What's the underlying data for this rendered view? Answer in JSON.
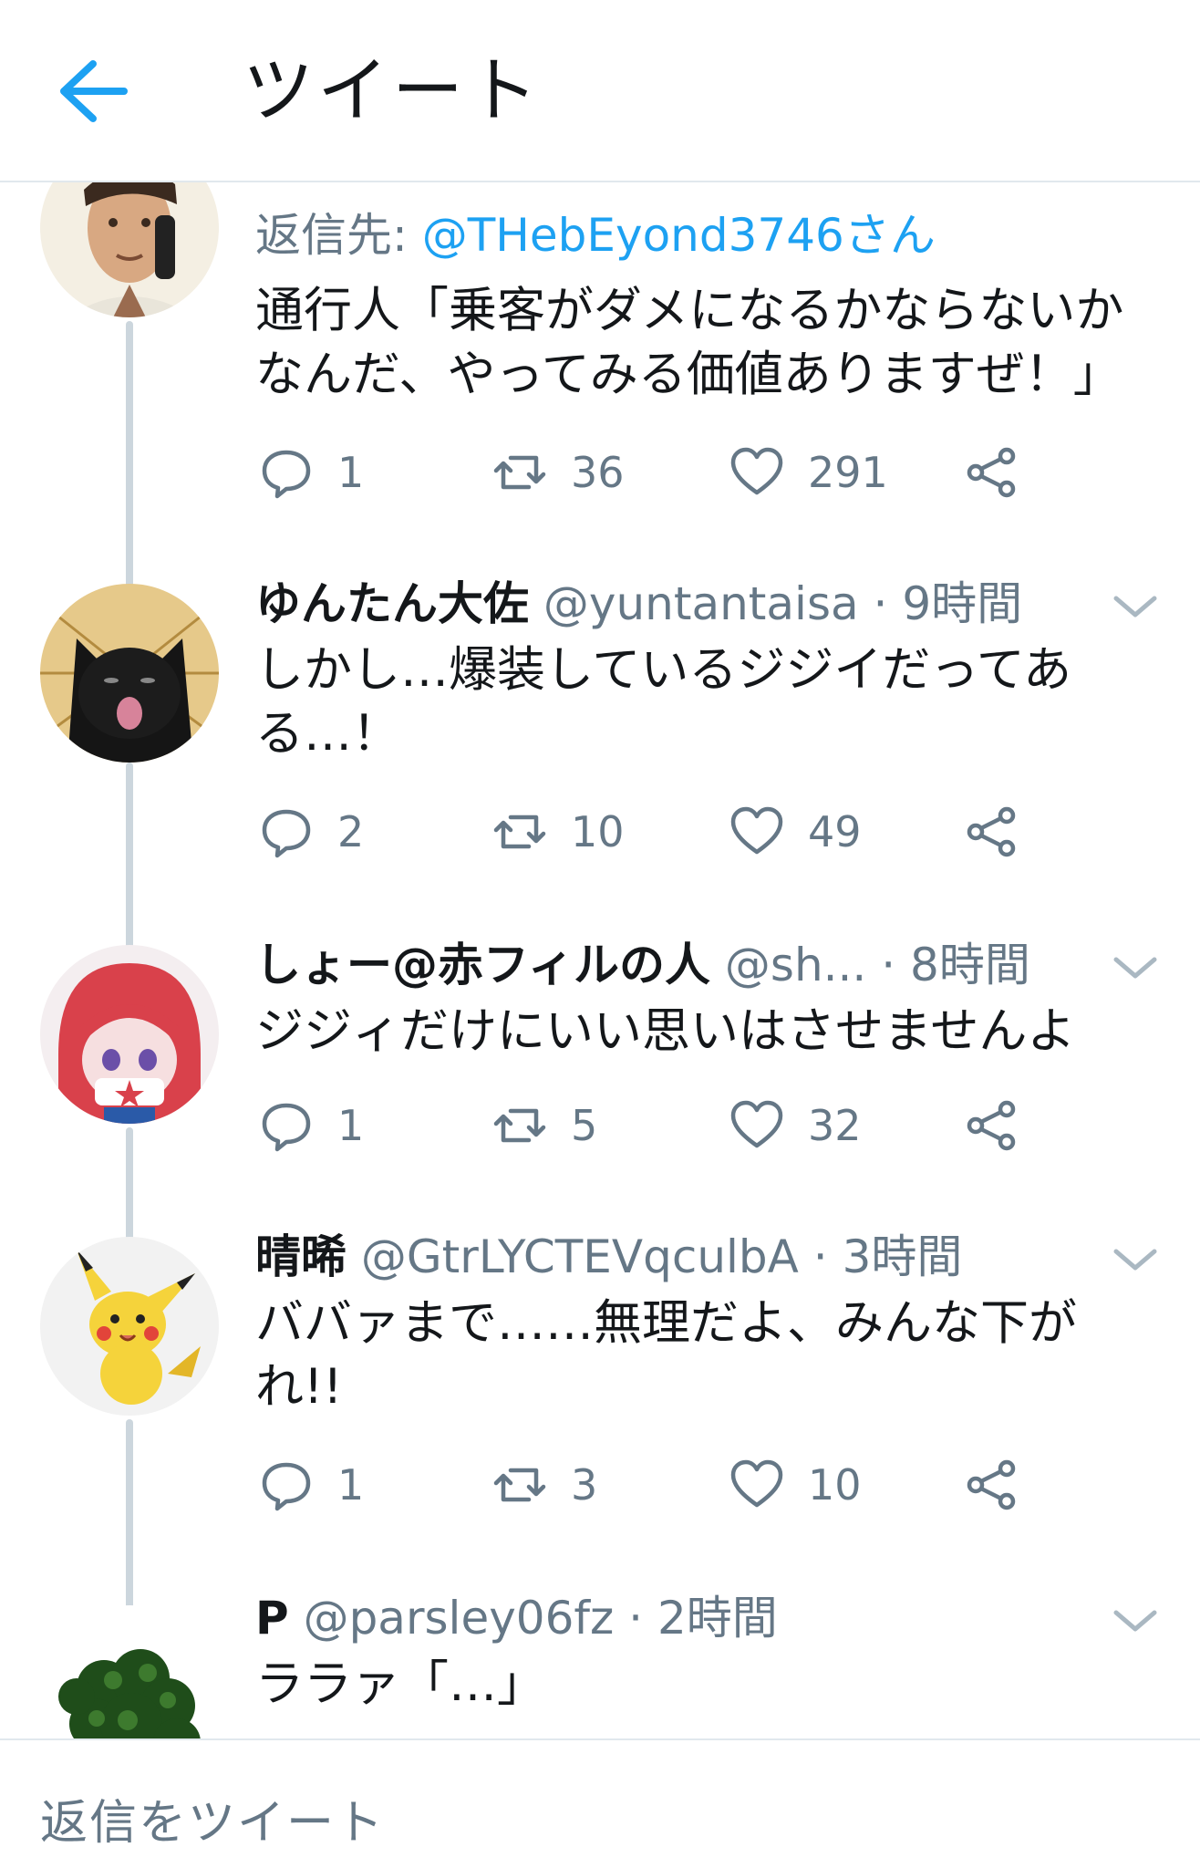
{
  "header": {
    "back_icon": "arrow-left-icon",
    "title": "ツイート",
    "accent_color": "#1da1f2"
  },
  "tweets": [
    {
      "avatar": "man-on-phone-avatar",
      "reply_prefix": "返信先:",
      "reply_mention": "@THebEyond3746さん",
      "text": "通行人「乗客がダメになるかならないかなんだ、やってみる価値ありますぜ！」",
      "replies": "1",
      "retweets": "36",
      "likes": "291"
    },
    {
      "avatar": "black-cat-avatar",
      "name": "ゆんたん大佐",
      "handle": "@yuntantaisa",
      "sep": "·",
      "time": "9時間",
      "text": "しかし…爆装しているジジイだってある…！",
      "replies": "2",
      "retweets": "10",
      "likes": "49"
    },
    {
      "avatar": "red-hair-girl-avatar",
      "name": "しょー@赤フィルの人",
      "handle": "@sh...",
      "sep": "·",
      "time": "8時間",
      "text": "ジジィだけにいい思いはさせませんよ",
      "replies": "1",
      "retweets": "5",
      "likes": "32"
    },
    {
      "avatar": "pikachu-avatar",
      "name": "晴晞",
      "handle": "@GtrLYCTEVqculbA",
      "sep": "·",
      "time": "3時間",
      "text": "ババァまで……無理だよ、みんな下がれ!!",
      "replies": "1",
      "retweets": "3",
      "likes": "10"
    },
    {
      "avatar": "parsley-avatar",
      "name": "P",
      "handle": "@parsley06fz",
      "sep": "·",
      "time": "2時間",
      "text": "ララァ「…」"
    }
  ],
  "compose": {
    "placeholder": "返信をツイート"
  },
  "colors": {
    "text": "#14171a",
    "secondary": "#657786",
    "thread_line": "#ccd6dd",
    "divider": "#e1e8ed"
  }
}
